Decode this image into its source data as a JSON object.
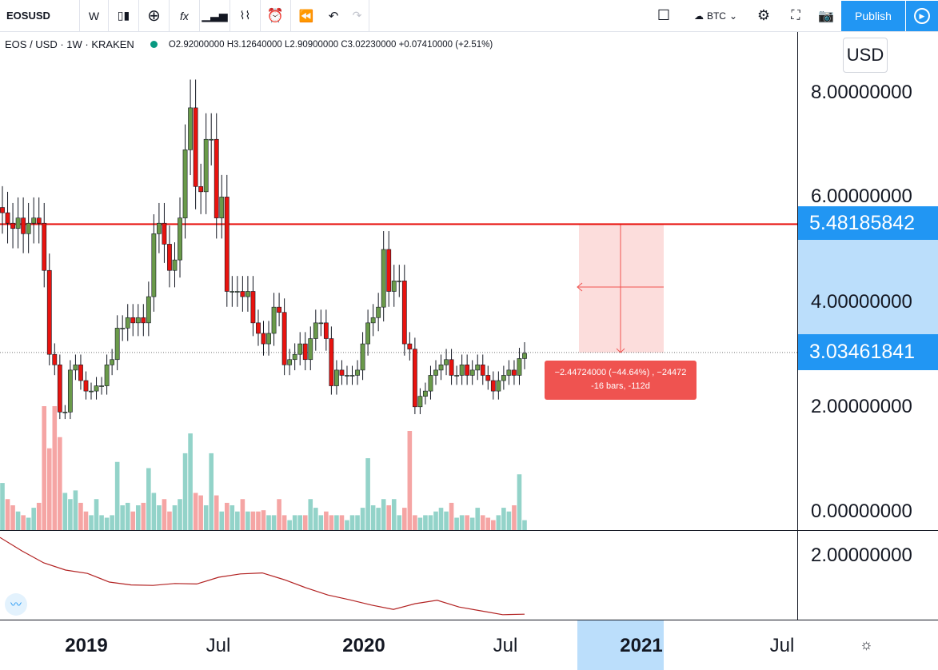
{
  "toolbar": {
    "symbol": "EOSUSD",
    "interval": "W",
    "compare_currency": "BTC",
    "publish_label": "Publish"
  },
  "legend": {
    "title": "EOS / USD · 1W · KRAKEN",
    "ohlc": "O2.92000000 H3.12640000 L2.90900000 C3.02230000 +0.07410000 (+2.51%)"
  },
  "currency_label": "USD",
  "price_axis": {
    "ticks": [
      "8.00000000",
      "6.00000000",
      "4.00000000",
      "2.00000000",
      "0.00000000"
    ],
    "indicator_tick": "2.00000000",
    "marker_high": "5.48185842",
    "marker_current": "3.03461841"
  },
  "time_axis": [
    "2019",
    "Jul",
    "2020",
    "Jul",
    "2021",
    "Jul"
  ],
  "measure": {
    "line1": "−2.44724000 (−44.64%) , −24472",
    "line2": "-16 bars, -112d"
  },
  "colors": {
    "up": "#6a9a4a",
    "down": "#e8130f",
    "accent": "#2196f3",
    "vol_up": "#93d3c9",
    "vol_down": "#f5a5a4",
    "indicator": "#b22222"
  },
  "chart_data": {
    "type": "candlestick",
    "interval": "1W",
    "start_week": "2018-09",
    "close": [
      5.7,
      5.5,
      5.4,
      5.6,
      5.3,
      5.5,
      5.6,
      5.5,
      4.6,
      3.0,
      2.8,
      1.9,
      1.9,
      2.7,
      2.8,
      2.5,
      2.3,
      2.3,
      2.4,
      2.4,
      2.8,
      2.9,
      3.5,
      3.5,
      3.7,
      3.6,
      3.7,
      3.6,
      4.1,
      5.3,
      5.5,
      5.1,
      4.6,
      4.8,
      5.6,
      6.9,
      7.7,
      6.2,
      6.1,
      7.1,
      7.1,
      5.6,
      6.0,
      4.2,
      4.2,
      4.2,
      4.1,
      4.2,
      3.6,
      3.4,
      3.2,
      3.4,
      3.9,
      3.8,
      2.8,
      2.9,
      3.0,
      3.2,
      2.9,
      3.3,
      3.6,
      3.6,
      3.3,
      2.4,
      2.7,
      2.6,
      2.6,
      2.6,
      2.7,
      3.2,
      3.6,
      3.7,
      3.9,
      5.0,
      4.2,
      4.4,
      4.4,
      3.2,
      3.1,
      2.0,
      2.2,
      2.3,
      2.6,
      2.7,
      2.8,
      2.9,
      2.6,
      2.6,
      2.8,
      2.6,
      2.7,
      2.8,
      2.6,
      2.5,
      2.3,
      2.5,
      2.6,
      2.7,
      2.6,
      2.92,
      3.02
    ],
    "volume": [
      38,
      25,
      20,
      15,
      12,
      10,
      18,
      22,
      100,
      66,
      100,
      75,
      30,
      25,
      32,
      22,
      15,
      12,
      25,
      12,
      10,
      12,
      55,
      20,
      22,
      15,
      20,
      22,
      50,
      30,
      20,
      25,
      15,
      20,
      25,
      62,
      78,
      30,
      28,
      20,
      62,
      28,
      15,
      22,
      20,
      15,
      25,
      15,
      15,
      15,
      16,
      12,
      12,
      25,
      12,
      8,
      12,
      12,
      12,
      25,
      18,
      12,
      15,
      12,
      12,
      12,
      8,
      12,
      12,
      18,
      58,
      20,
      18,
      25,
      20,
      25,
      12,
      18,
      80,
      12,
      10,
      12,
      12,
      15,
      18,
      15,
      22,
      10,
      12,
      12,
      10,
      18,
      12,
      10,
      8,
      12,
      18,
      15,
      20,
      45,
      8
    ],
    "indicator": [
      2.38,
      2.1,
      1.85,
      1.7,
      1.63,
      1.45,
      1.39,
      1.38,
      1.42,
      1.41,
      1.55,
      1.62,
      1.64,
      1.5,
      1.33,
      1.18,
      1.08,
      0.97,
      0.88,
      1.0,
      1.07,
      0.93,
      0.85,
      0.77,
      0.78
    ],
    "ylim": [
      0,
      9
    ],
    "levels": {
      "horizontal": 5.48185842,
      "current": 3.03461841
    }
  }
}
